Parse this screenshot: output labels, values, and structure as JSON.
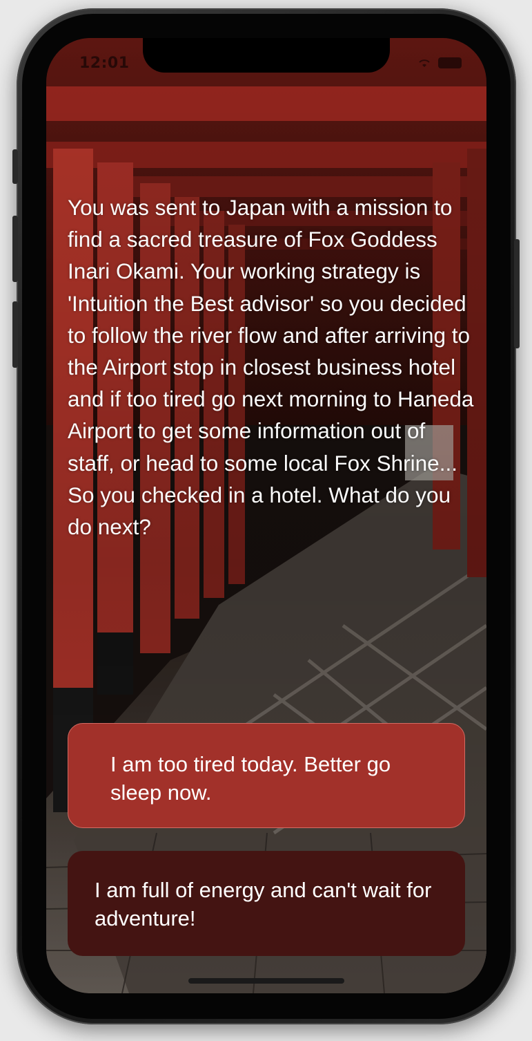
{
  "status_bar": {
    "time": "12:01",
    "wifi_icon": "wifi-icon",
    "battery_icon": "battery-icon"
  },
  "story": {
    "text": "You was sent to Japan with a mission to find a sacred treasure of Fox Goddess Inari Okami. Your working strategy is 'Intuition the Best advisor' so you decided to follow the river flow and after arriving to the Airport stop in closest business hotel and if too tired go next morning to Haneda Airport to get some information out of staff, or head to some local Fox Shrine... So you checked in a hotel. What do you do next?"
  },
  "choices": {
    "first": "I am too tired today. Better go sleep now.",
    "second": "I am full of energy and can't wait for adventure!"
  },
  "colors": {
    "choice_primary": "#a2312a",
    "choice_secondary": "#441412",
    "torii_red": "#b8322a",
    "text": "#fafafa"
  }
}
